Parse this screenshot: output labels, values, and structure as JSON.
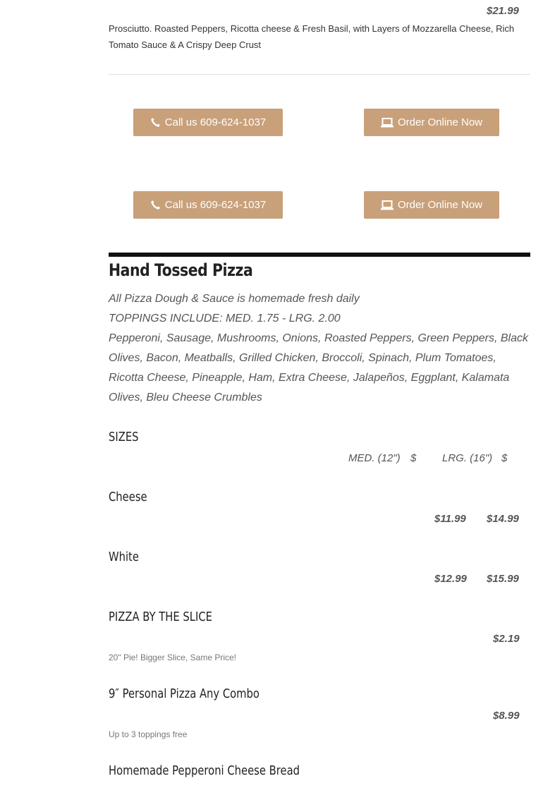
{
  "top_item": {
    "price": "$21.99",
    "description": "Prosciutto. Roasted Peppers, Ricotta cheese & Fresh Basil, with Layers of Mozzarella Cheese, Rich Tomato Sauce & A Crispy Deep Crust"
  },
  "cta_rows": [
    {
      "call_label": "Call us 609-624-1037",
      "order_label": "Order Online Now"
    },
    {
      "call_label": "Call us 609-624-1037",
      "order_label": "Order Online Now"
    }
  ],
  "section": {
    "title": "Hand Tossed Pizza",
    "intro_line1": "All Pizza Dough & Sauce is homemade fresh daily",
    "intro_line2": "TOPPINGS INCLUDE: MED. 1.75 - LRG. 2.00",
    "intro_line3": "Pepperoni, Sausage, Mushrooms, Onions, Roasted Peppers, Green Peppers, Black Olives, Bacon, Meatballs, Grilled Chicken, Broccoli, Spinach, Plum Tomatoes, Ricotta Cheese, Pineapple, Ham, Extra Cheese, Jalapeños, Eggplant, Kalamata Olives, Bleu Cheese Crumbles"
  },
  "sizes": {
    "heading": "SIZES",
    "med_label": "MED. (12\")",
    "med_currency": "$",
    "lrg_label": "LRG. (16\")",
    "lrg_currency": "$"
  },
  "items": [
    {
      "name": "Cheese",
      "price_med": "$11.99",
      "price_lrg": "$14.99"
    },
    {
      "name": "White",
      "price_med": "$12.99",
      "price_lrg": "$15.99"
    },
    {
      "name": "PIZZA BY THE SLICE",
      "price": "$2.19",
      "note": "20\" Pie! Bigger Slice, Same Price!"
    },
    {
      "name": "9″ Personal Pizza Any Combo",
      "price": "$8.99",
      "note": "Up to 3 toppings free"
    },
    {
      "name": "Homemade Pepperoni Cheese Bread"
    }
  ],
  "colors": {
    "button": "#c8a07a",
    "rule": "#111111"
  }
}
